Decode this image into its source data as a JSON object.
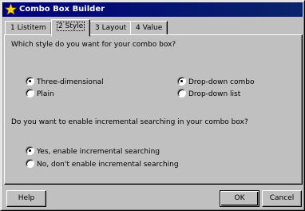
{
  "window": {
    "title": "Combo Box Builder"
  },
  "tabs": [
    {
      "label": "1 Listitem",
      "active": false
    },
    {
      "label": "2 Style",
      "active": true
    },
    {
      "label": "3 Layout",
      "active": false
    },
    {
      "label": "4 Value",
      "active": false
    }
  ],
  "style_question": "Which style do you want for your combo box?",
  "style_options": {
    "three_d": {
      "label": "Three-dimensional",
      "checked": true
    },
    "plain": {
      "label": "Plain",
      "checked": false
    },
    "dropdown_combo": {
      "label": "Drop-down combo",
      "checked": true
    },
    "dropdown_list": {
      "label": "Drop-down list",
      "checked": false
    }
  },
  "search_question": "Do you want to enable incremental searching in your combo box?",
  "search_options": {
    "yes": {
      "label": "Yes, enable incremental searching",
      "checked": true
    },
    "no": {
      "label": "No, don't enable incremental searching",
      "checked": false
    }
  },
  "buttons": {
    "help": "Help",
    "ok": "OK",
    "cancel": "Cancel"
  },
  "colors": {
    "titlebar": "#00007b",
    "face": "#c0c0c0"
  }
}
